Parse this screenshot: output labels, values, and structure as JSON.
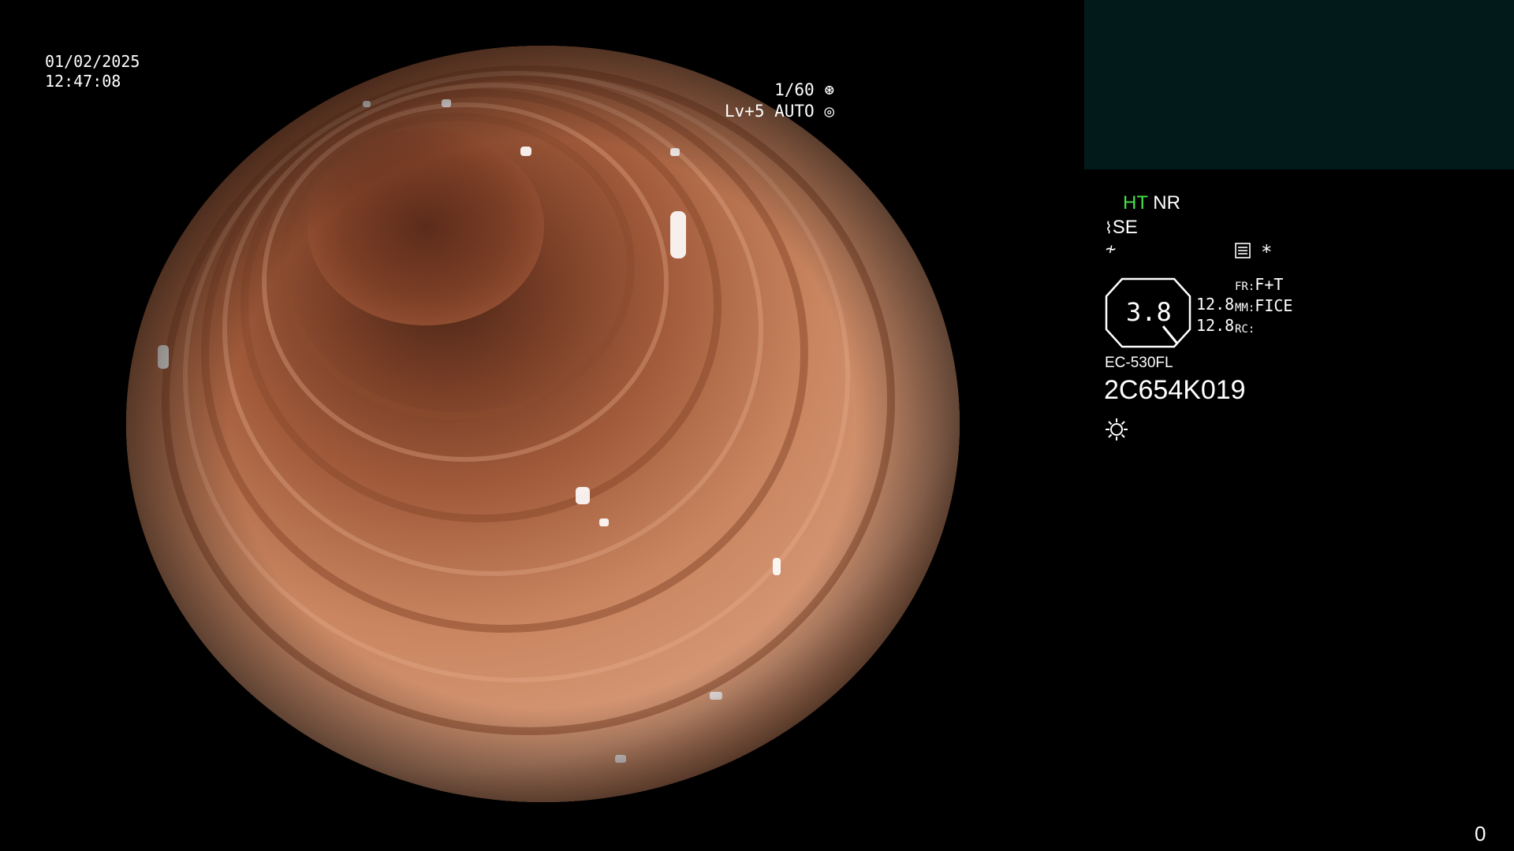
{
  "overlay": {
    "date": "01/02/2025",
    "time": "12:47:08",
    "shutter": "1/60",
    "level_auto": "Lv+5 AUTO",
    "frame_counter": "0"
  },
  "panel": {
    "ht": "HT",
    "nr": "NR",
    "se": "SE",
    "star": "*",
    "iris_value": "3.8",
    "val1": "12.8",
    "val2": "12.8",
    "fr_label": "FR:",
    "fr_value": "F+T",
    "mm_label": "MM:",
    "mm_value": "FICE",
    "rc_label": "RC:",
    "scope_model": "EC-530FL",
    "serial": "2C654K019"
  },
  "colors": {
    "accent_green": "#47e347",
    "panel_teal": "#021a1a",
    "mucosa": "#c98560"
  },
  "icons": [
    "shutter-icon",
    "auto-icon",
    "scope-icon",
    "enhance-icon",
    "menu-icon",
    "light-icon"
  ]
}
